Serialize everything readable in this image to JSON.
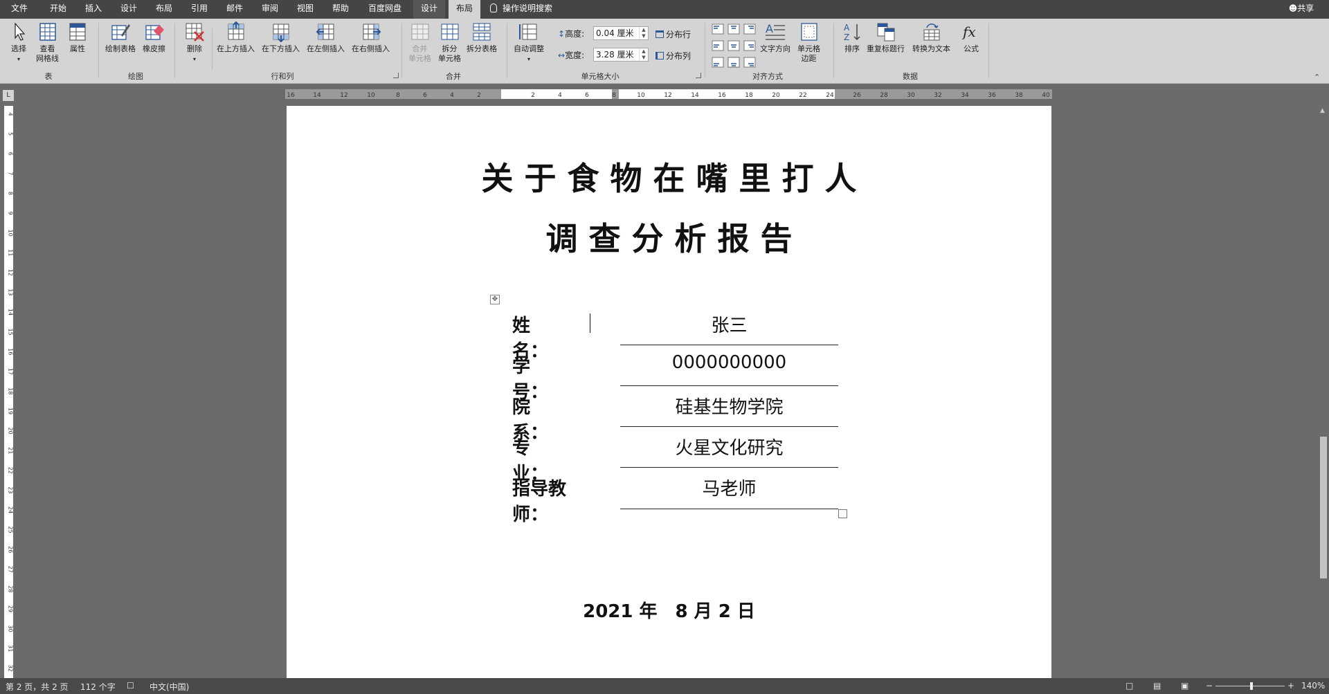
{
  "menubar": {
    "tabs": [
      "文件",
      "开始",
      "插入",
      "设计",
      "布局",
      "引用",
      "邮件",
      "审阅",
      "视图",
      "帮助",
      "百度网盘",
      "设计",
      "布局"
    ],
    "search_label": "操作说明搜索",
    "share_label": "共享"
  },
  "ribbon": {
    "table": {
      "select": "选择",
      "view_grid_1": "查看",
      "view_grid_2": "网格线",
      "properties": "属性",
      "group": "表"
    },
    "draw": {
      "draw_table": "绘制表格",
      "eraser": "橡皮擦",
      "group": "绘图"
    },
    "rows_cols": {
      "delete": "删除",
      "insert_above": "在上方插入",
      "insert_below": "在下方插入",
      "insert_left": "在左侧插入",
      "insert_right": "在右侧插入",
      "group": "行和列"
    },
    "merge": {
      "merge_1": "合并",
      "merge_2": "单元格",
      "split_1": "拆分",
      "split_2": "单元格",
      "split_table": "拆分表格",
      "group": "合并"
    },
    "cell_size": {
      "autofit": "自动调整",
      "height_label": "高度:",
      "height_value": "0.04 厘米",
      "width_label": "宽度:",
      "width_value": "3.28 厘米",
      "distribute_rows": "分布行",
      "distribute_cols": "分布列",
      "group": "单元格大小"
    },
    "alignment": {
      "text_direction": "文字方向",
      "cell_margins_1": "单元格",
      "cell_margins_2": "边距",
      "group": "对齐方式"
    },
    "data": {
      "sort": "排序",
      "repeat_header": "重复标题行",
      "convert_text": "转换为文本",
      "formula": "公式",
      "group": "数据"
    }
  },
  "ruler": {
    "h_ticks": [
      "16",
      "14",
      "12",
      "10",
      "8",
      "6",
      "4",
      "2",
      "2",
      "4",
      "6",
      "8",
      "10",
      "12",
      "14",
      "16",
      "18",
      "20",
      "22",
      "24",
      "26",
      "28",
      "30",
      "32",
      "34",
      "36",
      "38",
      "40"
    ],
    "v_ticks": [
      "4",
      "5",
      "6",
      "7",
      "8",
      "9",
      "10",
      "11",
      "12",
      "13",
      "14",
      "15",
      "16",
      "17",
      "18",
      "19",
      "20",
      "21",
      "22",
      "23",
      "24",
      "25",
      "26",
      "27",
      "28",
      "29",
      "30",
      "31",
      "32"
    ]
  },
  "document": {
    "title_line1": "关 于 食 物 在 嘴 里 打 人",
    "title_line2": "调 查 分 析 报 告",
    "fields": [
      {
        "label": "姓　　名：",
        "value": "张三"
      },
      {
        "label": "学　　号：",
        "value": "0000000000"
      },
      {
        "label": "院　　系：",
        "value": "硅基生物学院"
      },
      {
        "label": "专　　业：",
        "value": "火星文化研究"
      },
      {
        "label": "指导教师：",
        "value": "马老师"
      }
    ],
    "date": "2021 年　8 月 2 日"
  },
  "status": {
    "page_info": "第 2 页，共 2 页",
    "word_count": "112 个字",
    "language": "中文(中国)",
    "zoom": "140%"
  }
}
